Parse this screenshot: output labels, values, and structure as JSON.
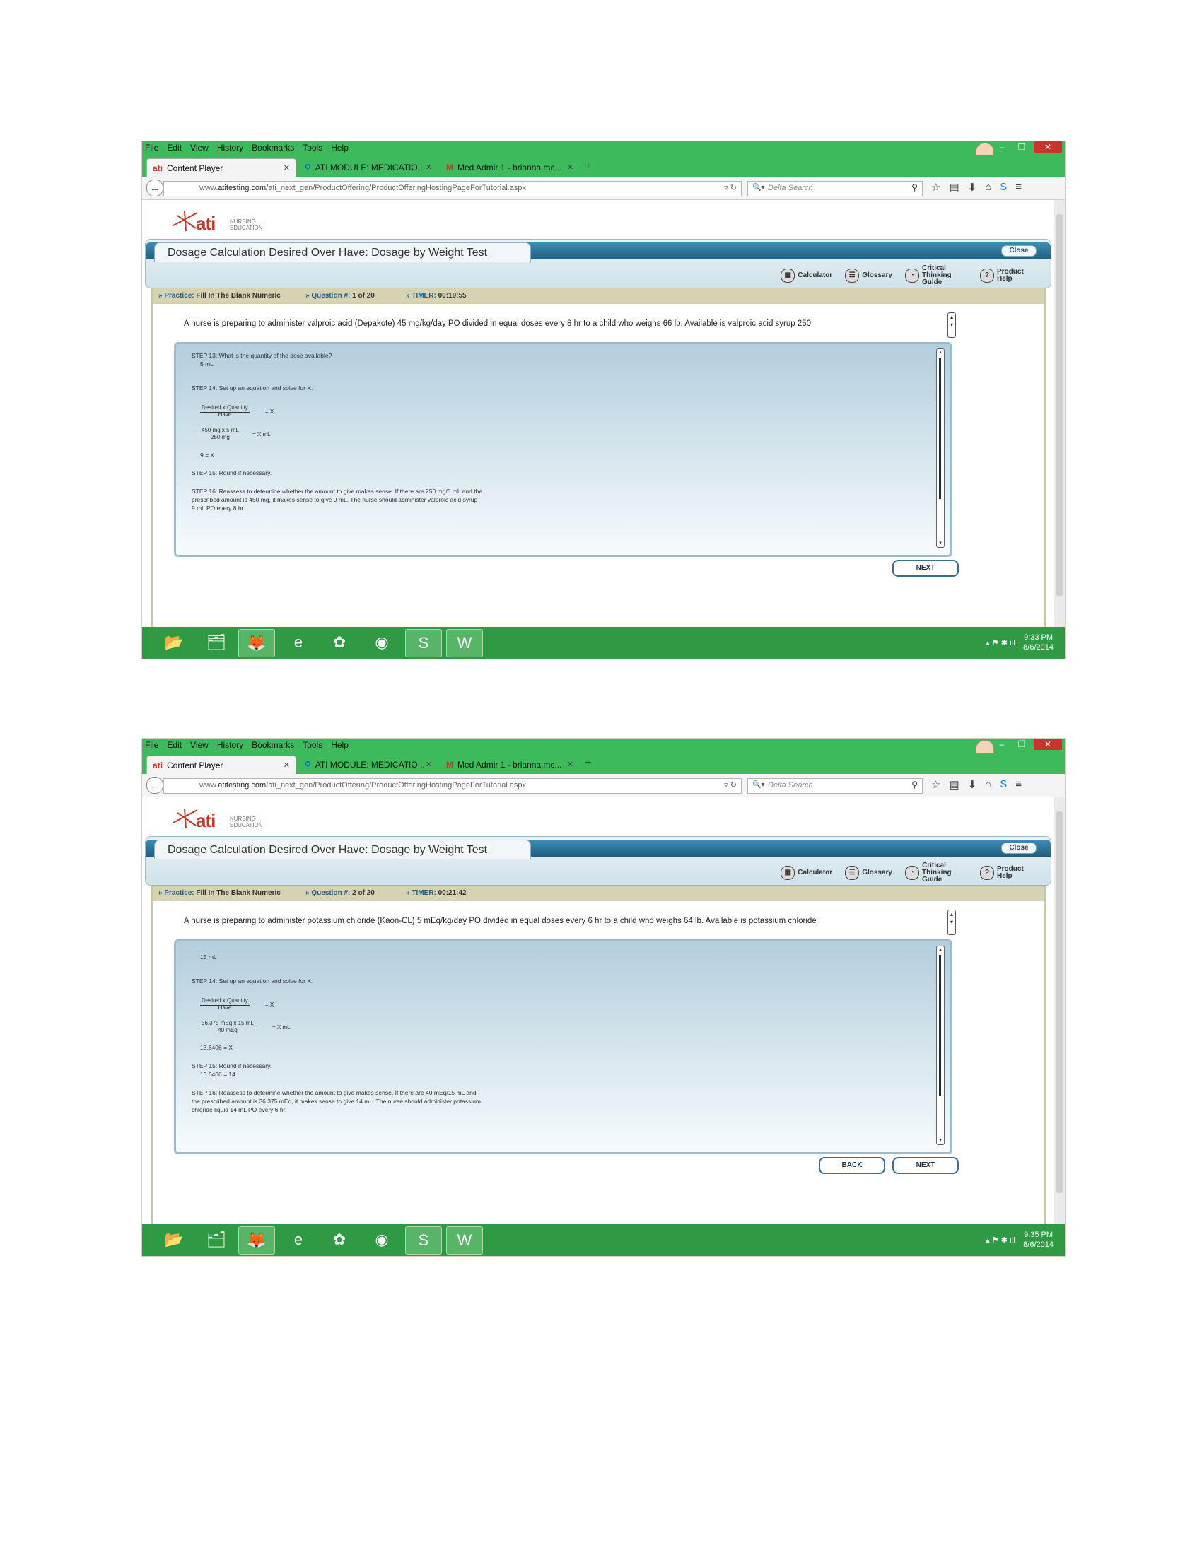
{
  "browser": {
    "menu": [
      "File",
      "Edit",
      "View",
      "History",
      "Bookmarks",
      "Tools",
      "Help"
    ],
    "tabs": [
      {
        "label": "Content Player",
        "icon": "ati"
      },
      {
        "label": "ATI MODULE: MEDICATIO...",
        "icon": "location-pin"
      },
      {
        "label": "Med Admir 1 - brianna.mc...",
        "icon": "gmail"
      }
    ],
    "url_prefix": "www.",
    "url_domain": "atitesting.com",
    "url_path": "/ati_next_gen/ProductOffering/ProductOfferingHostingPageForTutorial.aspx",
    "search_placeholder": "Delta Search"
  },
  "app": {
    "logo_brand": "ati",
    "logo_sub1": "NURSING",
    "logo_sub2": "EDUCATION",
    "title": "Dosage Calculation Desired Over Have: Dosage by Weight Test",
    "close_label": "Close",
    "tools": [
      {
        "label": "Calculator",
        "icon": "calculator-icon"
      },
      {
        "label": "Glossary",
        "icon": "glossary-icon"
      },
      {
        "label": "Critical Thinking Guide",
        "icon": "critical-thinking-icon"
      },
      {
        "label": "Product Help",
        "icon": "help-icon"
      }
    ],
    "practice_label": "Practice:",
    "practice_value": "Fill In The Blank Numeric",
    "question_label": "Question #:",
    "timer_label": "TIMER:",
    "next_label": "NEXT",
    "back_label": "BACK"
  },
  "screens": [
    {
      "question_num": "1 of 20",
      "timer": "00:19:55",
      "question": "A nurse is preparing to administer valproic acid (Depakote) 45 mg/kg/day PO divided in equal doses every 8 hr to a child who weighs 66 lb. Available is valproic acid syrup 250",
      "step13_title": "STEP 13: What is the quantity of the dose available?",
      "step13_value": "5 mL",
      "step14_title": "STEP 14:  Set up an equation and solve for X.",
      "formula_num": "Desired x Quantity",
      "formula_den": "Have",
      "formula_rhs": "= X",
      "calc_num": "450 mg x 5 mL",
      "calc_den": "250 mg",
      "calc_rhs": "= X mL",
      "result": "9 = X",
      "step15_title": "STEP 15: Round if necessary.",
      "step15_value": "",
      "step16_line1": "STEP 16: Reassess to determine whether the amount to give makes sense. If there are 250 mg/5 mL and the",
      "step16_line2": "prescribed amount is 450 mg, it makes sense to give 9 mL. The nurse should administer valproic acid syrup",
      "step16_line3": "9 mL PO every 8 hr.",
      "clock_time": "9:33 PM",
      "clock_date": "8/6/2014"
    },
    {
      "question_num": "2 of 20",
      "timer": "00:21:42",
      "question": "A nurse is preparing to administer potassium chloride (Kaon-CL) 5 mEq/kg/day PO divided in equal doses every 6 hr to a child who weighs 64 lb. Available is potassium chloride",
      "step13_title": "",
      "step13_value": "15 mL",
      "step14_title": "STEP 14:  Set up an equation and solve for X.",
      "formula_num": "Desired x Quantity",
      "formula_den": "Have",
      "formula_rhs": "= X",
      "calc_num": "36.375 mEq x 15 mL",
      "calc_den": "40 mEq",
      "calc_rhs": "= X mL",
      "result": "13.6406 = X",
      "step15_title": "STEP 15: Round if necessary.",
      "step15_value": "13.6406 = 14",
      "step16_line1": "STEP 16: Reassess to determine whether the amount to give makes sense. If there are 40 mEq/15 mL and",
      "step16_line2": "the prescribed amount is 36.375 mEq, it makes sense to give 14 mL. The nurse should administer potassium",
      "step16_line3": "chloride liquid 14 mL PO every 6 hr.",
      "clock_time": "9:35 PM",
      "clock_date": "8/6/2014"
    }
  ],
  "taskbar": [
    "file-explorer-icon",
    "libraries-icon",
    "firefox-icon",
    "internet-explorer-icon",
    "picasa-icon",
    "chrome-icon",
    "skype-icon",
    "word-icon"
  ]
}
